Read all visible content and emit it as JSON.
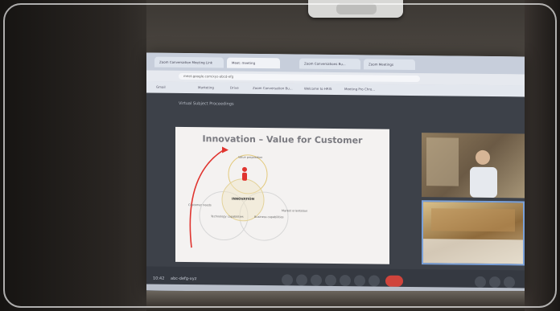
{
  "browser": {
    "tabs": [
      "Zoom Conversation Meeting Link",
      "Meet: meeting",
      "Zoom Conversations Bu...",
      "Zoom Meetings"
    ],
    "url": "meet.google.com/xyz-abcd-efg",
    "bookmarks": [
      "Gmail",
      "Marketing",
      "Drive",
      "Zoom Conversation Bu...",
      "Welcome to HRIS",
      "Meeting Pro Chro..."
    ]
  },
  "meet": {
    "title": "Virtual Subject Proceedings",
    "time": "10:42",
    "code": "abc-defg-xyz"
  },
  "slide": {
    "title": "Innovation – Value for Customer",
    "center_label": "INNOVATION",
    "labels": [
      "Value proposition",
      "Technology capabilities",
      "Business capabilities",
      "Market orientation",
      "Customer needs"
    ]
  },
  "colors": {
    "accent_red": "#e0342f",
    "hangup": "#d0443c"
  }
}
